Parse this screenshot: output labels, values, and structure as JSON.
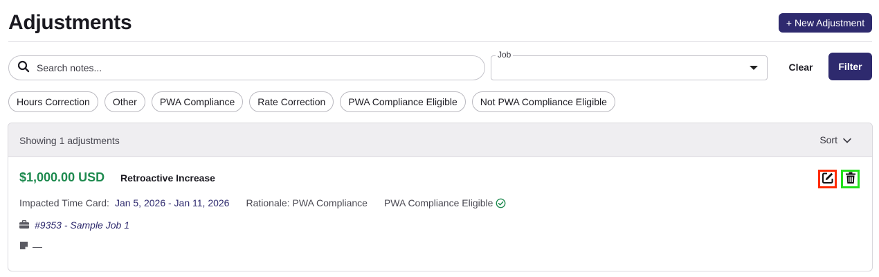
{
  "header": {
    "title": "Adjustments",
    "new_button": "+ New Adjustment"
  },
  "filters": {
    "search_placeholder": "Search notes...",
    "search_value": "",
    "job_label": "Job",
    "job_value": "",
    "clear_label": "Clear",
    "filter_label": "Filter"
  },
  "chips": [
    "Hours Correction",
    "Other",
    "PWA Compliance",
    "Rate Correction",
    "PWA Compliance Eligible",
    "Not PWA Compliance Eligible"
  ],
  "results": {
    "count_text": "Showing 1 adjustments",
    "sort_label": "Sort"
  },
  "adjustment": {
    "amount": "$1,000.00 USD",
    "reason": "Retroactive Increase",
    "impacted_label": "Impacted Time Card:",
    "impacted_range": "Jan 5, 2026 - Jan 11, 2026",
    "rationale_label": "Rationale:",
    "rationale_value": "PWA Compliance",
    "eligibility": "PWA Compliance Eligible",
    "job": "#9353 - Sample Job 1",
    "note": "—"
  },
  "icons": {
    "search": "search-icon",
    "job_caret": "caret-down-icon",
    "sort_chevron": "chevron-down-icon",
    "edit": "edit-icon",
    "delete": "trash-icon",
    "eligible_check": "check-circle-icon",
    "job": "briefcase-icon",
    "note": "note-icon"
  },
  "colors": {
    "primary": "#2e2a6e",
    "amount": "#1e8a4f",
    "edit_highlight": "#ff2a00",
    "delete_highlight": "#22e01a"
  }
}
